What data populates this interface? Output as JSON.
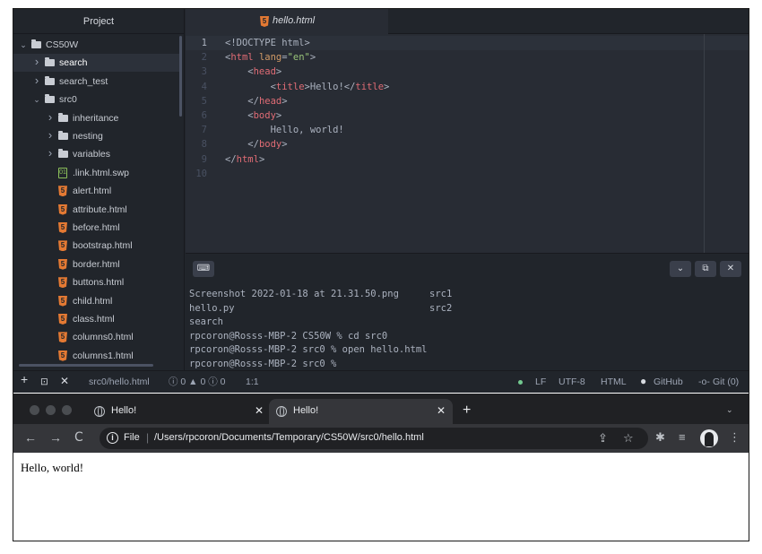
{
  "editor": {
    "tree_header": "Project",
    "tree": [
      {
        "label": "CS50W",
        "type": "folder",
        "expanded": true,
        "depth": 0,
        "selected": false
      },
      {
        "label": "search",
        "type": "folder",
        "expanded": false,
        "depth": 1,
        "selected": true
      },
      {
        "label": "search_test",
        "type": "folder",
        "expanded": false,
        "depth": 1,
        "selected": false
      },
      {
        "label": "src0",
        "type": "folder",
        "expanded": true,
        "depth": 1,
        "selected": false
      },
      {
        "label": "inheritance",
        "type": "folder",
        "expanded": false,
        "depth": 2,
        "selected": false
      },
      {
        "label": "nesting",
        "type": "folder",
        "expanded": false,
        "depth": 2,
        "selected": false
      },
      {
        "label": "variables",
        "type": "folder",
        "expanded": false,
        "depth": 2,
        "selected": false
      },
      {
        "label": ".link.html.swp",
        "type": "swp",
        "depth": 2,
        "selected": false
      },
      {
        "label": "alert.html",
        "type": "html",
        "depth": 2,
        "selected": false
      },
      {
        "label": "attribute.html",
        "type": "html",
        "depth": 2,
        "selected": false
      },
      {
        "label": "before.html",
        "type": "html",
        "depth": 2,
        "selected": false
      },
      {
        "label": "bootstrap.html",
        "type": "html",
        "depth": 2,
        "selected": false
      },
      {
        "label": "border.html",
        "type": "html",
        "depth": 2,
        "selected": false
      },
      {
        "label": "buttons.html",
        "type": "html",
        "depth": 2,
        "selected": false
      },
      {
        "label": "child.html",
        "type": "html",
        "depth": 2,
        "selected": false
      },
      {
        "label": "class.html",
        "type": "html",
        "depth": 2,
        "selected": false
      },
      {
        "label": "columns0.html",
        "type": "html",
        "depth": 2,
        "selected": false
      },
      {
        "label": "columns1.html",
        "type": "html",
        "depth": 2,
        "selected": false
      }
    ],
    "tab_title": "hello.html",
    "code_lines": [
      {
        "num": "1",
        "active": true,
        "tokens": [
          {
            "c": "p",
            "t": "<!DOCTYPE html>"
          }
        ]
      },
      {
        "num": "2",
        "tokens": [
          {
            "c": "p",
            "t": "<"
          },
          {
            "c": "tag",
            "t": "html"
          },
          {
            "c": "p",
            "t": " "
          },
          {
            "c": "attr",
            "t": "lang"
          },
          {
            "c": "p",
            "t": "="
          },
          {
            "c": "str",
            "t": "\"en\""
          },
          {
            "c": "p",
            "t": ">"
          }
        ]
      },
      {
        "num": "3",
        "tokens": [
          {
            "c": "p",
            "t": "    <"
          },
          {
            "c": "tag",
            "t": "head"
          },
          {
            "c": "p",
            "t": ">"
          }
        ]
      },
      {
        "num": "4",
        "tokens": [
          {
            "c": "p",
            "t": "        <"
          },
          {
            "c": "tag",
            "t": "title"
          },
          {
            "c": "p",
            "t": ">Hello!</"
          },
          {
            "c": "tag",
            "t": "title"
          },
          {
            "c": "p",
            "t": ">"
          }
        ]
      },
      {
        "num": "5",
        "tokens": [
          {
            "c": "p",
            "t": "    </"
          },
          {
            "c": "tag",
            "t": "head"
          },
          {
            "c": "p",
            "t": ">"
          }
        ]
      },
      {
        "num": "6",
        "tokens": [
          {
            "c": "p",
            "t": "    <"
          },
          {
            "c": "tag",
            "t": "body"
          },
          {
            "c": "p",
            "t": ">"
          }
        ]
      },
      {
        "num": "7",
        "tokens": [
          {
            "c": "p",
            "t": "        Hello, world!"
          }
        ]
      },
      {
        "num": "8",
        "tokens": [
          {
            "c": "p",
            "t": "    </"
          },
          {
            "c": "tag",
            "t": "body"
          },
          {
            "c": "p",
            "t": ">"
          }
        ]
      },
      {
        "num": "9",
        "tokens": [
          {
            "c": "p",
            "t": "</"
          },
          {
            "c": "tag",
            "t": "html"
          },
          {
            "c": "p",
            "t": ">"
          }
        ]
      },
      {
        "num": "10",
        "tokens": []
      }
    ],
    "terminal": {
      "keyboard_button": "⌨",
      "chevron_button": "⌄",
      "maximize_button": "⧉",
      "close_button": "✕",
      "lines": [
        {
          "left": "Screenshot 2022-01-18 at 21.31.50.png",
          "right": "src1"
        },
        {
          "left": "hello.py",
          "right": "src2"
        },
        {
          "left": "search",
          "right": ""
        },
        {
          "left": "rpcoron@Rosss-MBP-2 CS50W % cd src0",
          "right": ""
        },
        {
          "left": "rpcoron@Rosss-MBP-2 src0 % open hello.html",
          "right": ""
        },
        {
          "left": "rpcoron@Rosss-MBP-2 src0 %",
          "right": ""
        }
      ]
    },
    "status": {
      "add": "+",
      "term_icon": "⊡",
      "close": "✕",
      "file_path": "src0/hello.html",
      "diagnostics": "ⓘ 0 ▲ 0 ⓘ 0",
      "cursor": "1:1",
      "line_ending": "LF",
      "encoding": "UTF-8",
      "grammar": "HTML",
      "github": "GitHub",
      "git": "Git (0)",
      "dot_color": "#73c990"
    }
  },
  "browser": {
    "tabs": [
      {
        "title": "Hello!",
        "close": "✕",
        "active": false
      },
      {
        "title": "Hello!",
        "close": "✕",
        "active": true
      }
    ],
    "new_tab": "+",
    "tab_menu": "⌄",
    "nav": {
      "back": "←",
      "forward": "→",
      "reload": "C"
    },
    "omnibox": {
      "info": "i",
      "scheme_label": "File",
      "separator": "|",
      "url": "/Users/rpcoron/Documents/Temporary/CS50W/src0/hello.html"
    },
    "toolbar_icons": {
      "share": "⇪",
      "star": "☆",
      "extensions": "✱",
      "reading_list": "≡",
      "menu": "⋮"
    },
    "page_text": "Hello, world!"
  }
}
